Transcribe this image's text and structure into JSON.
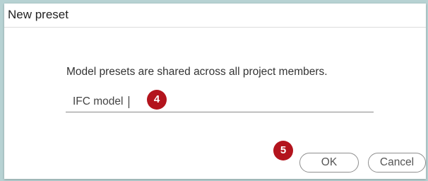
{
  "dialog": {
    "title": "New preset",
    "message": "Model presets are shared across all project members.",
    "input": {
      "value": "IFC model",
      "placeholder": ""
    },
    "buttons": {
      "ok_label": "OK",
      "cancel_label": "Cancel"
    },
    "annotations": [
      "4",
      "5"
    ]
  },
  "colors": {
    "background": "#b7d2d3",
    "badge": "#b3141d",
    "dialog": "#ffffff"
  }
}
